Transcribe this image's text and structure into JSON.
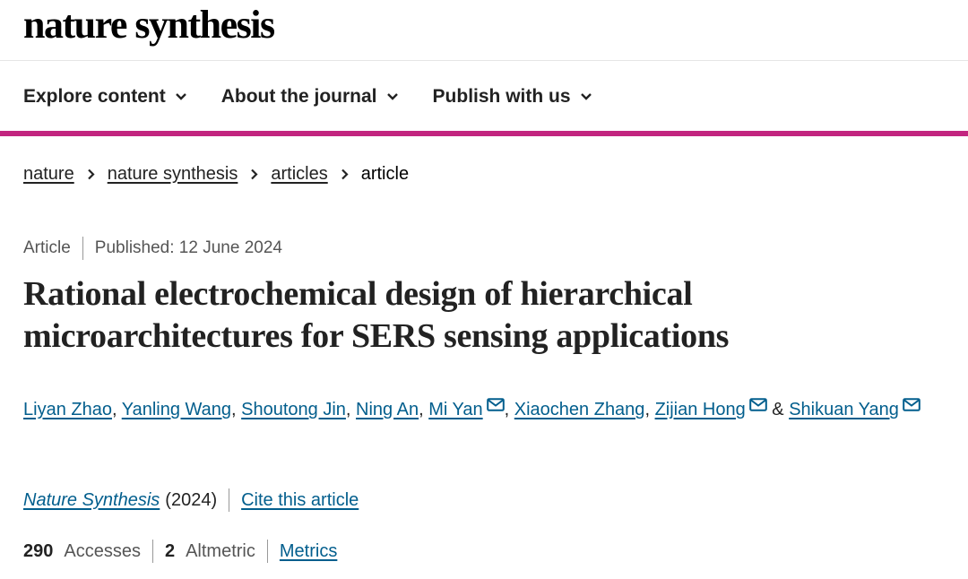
{
  "site": {
    "logo": "nature synthesis"
  },
  "nav": {
    "items": [
      {
        "label": "Explore content"
      },
      {
        "label": "About the journal"
      },
      {
        "label": "Publish with us"
      }
    ]
  },
  "breadcrumb": {
    "items": [
      {
        "label": "nature"
      },
      {
        "label": "nature synthesis"
      },
      {
        "label": "articles"
      }
    ],
    "current": "article"
  },
  "article": {
    "type": "Article",
    "published": "Published: 12 June 2024",
    "title": "Rational electrochemical design of hierarchical microarchitectures for SERS sensing applications",
    "authors": [
      "Liyan Zhao",
      "Yanling Wang",
      "Shoutong Jin",
      "Ning An",
      "Mi Yan",
      "Xiaochen Zhang",
      "Zijian Hong",
      "Shikuan Yang"
    ],
    "journal": "Nature Synthesis",
    "year": "(2024)",
    "cite_label": "Cite this article",
    "accesses_count": "290",
    "accesses_label": "Accesses",
    "altmetric_count": "2",
    "altmetric_label": "Altmetric",
    "metrics_label": "Metrics"
  },
  "icons": {
    "nav_chevron": "chevron-down-icon",
    "breadcrumb_separator": "chevron-right-icon",
    "corresponding_author": "mail-icon"
  },
  "colors": {
    "accent": "#c2257f",
    "link": "#025e8d"
  }
}
